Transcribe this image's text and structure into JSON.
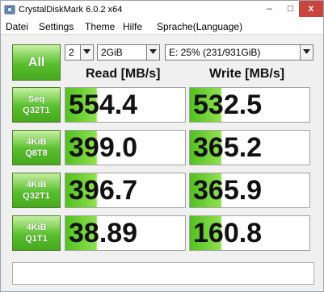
{
  "window": {
    "title": "CrystalDiskMark 6.0.2 x64"
  },
  "titlebar": {
    "minimize": "–",
    "maximize": "□",
    "close": "x"
  },
  "menu": [
    "Datei",
    "Settings",
    "Theme",
    "Hilfe",
    "Sprache(Language)"
  ],
  "controls": {
    "all_label": "All",
    "count": "2",
    "size": "2GiB",
    "drive": "E: 25% (231/931GiB)"
  },
  "headers": {
    "read": "Read [MB/s]",
    "write": "Write [MB/s]"
  },
  "rows": [
    {
      "line1": "Seq",
      "line2": "Q32T1",
      "read": "554.4",
      "write": "532.5"
    },
    {
      "line1": "4KiB",
      "line2": "Q8T8",
      "read": "399.0",
      "write": "365.2"
    },
    {
      "line1": "4KiB",
      "line2": "Q32T1",
      "read": "396.7",
      "write": "365.9"
    },
    {
      "line1": "4KiB",
      "line2": "Q1T1",
      "read": "38.89",
      "write": "160.8"
    }
  ],
  "comment": "",
  "colors": {
    "accent_green": "#58bf2d",
    "close_red": "#c9463d"
  }
}
